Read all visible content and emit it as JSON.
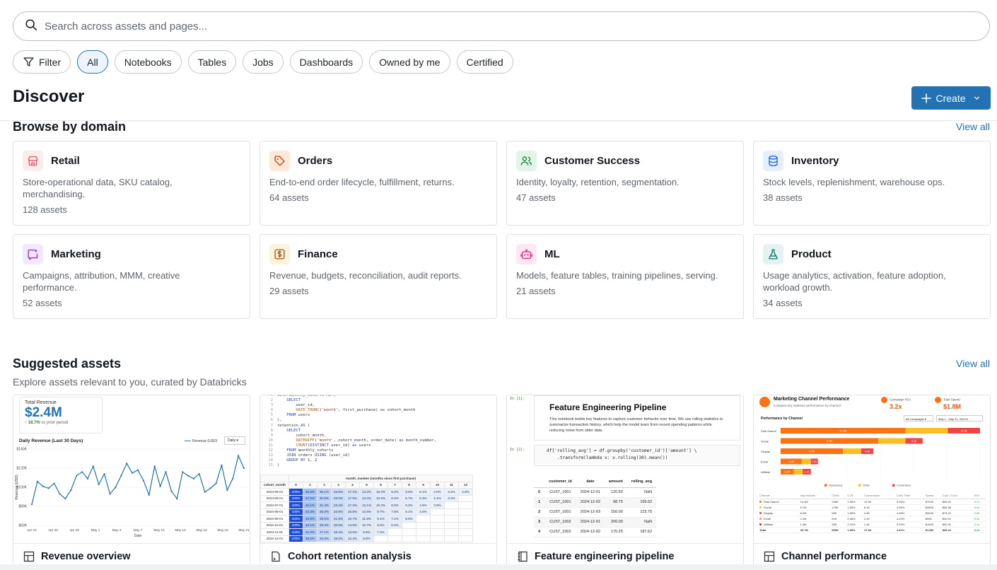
{
  "search": {
    "placeholder": "Search across assets and pages..."
  },
  "filters": {
    "filter_label": "Filter",
    "chips": [
      "All",
      "Notebooks",
      "Tables",
      "Jobs",
      "Dashboards",
      "Owned by me",
      "Certified"
    ],
    "active": "All"
  },
  "header": {
    "title": "Discover",
    "create_label": "Create"
  },
  "browse": {
    "title": "Browse by domain",
    "view_all": "View all",
    "domains": [
      {
        "name": "Retail",
        "desc": "Store-operational data, SKU catalog, merchandising.",
        "count": "128 assets",
        "icon": "store-icon",
        "color": "#e35d6a",
        "bg": "#fdecee"
      },
      {
        "name": "Orders",
        "desc": "End-to-end order lifecycle, fulfillment, returns.",
        "count": "64 assets",
        "icon": "tag-icon",
        "color": "#c2410c",
        "bg": "#fde9d7"
      },
      {
        "name": "Customer Success",
        "desc": "Identity, loyalty, retention, segmentation.",
        "count": "47 assets",
        "icon": "users-icon",
        "color": "#15803d",
        "bg": "#e3f4e9"
      },
      {
        "name": "Inventory",
        "desc": "Stock levels, replenishment, warehouse ops.",
        "count": "38 assets",
        "icon": "database-icon",
        "color": "#2563eb",
        "bg": "#e6effc"
      },
      {
        "name": "Marketing",
        "desc": "Campaigns, attribution, MMM, creative performance.",
        "count": "52 assets",
        "icon": "sparkle-message-icon",
        "color": "#9333ea",
        "bg": "#f3e8fd"
      },
      {
        "name": "Finance",
        "desc": "Revenue, budgets, reconciliation, audit reports.",
        "count": "29 assets",
        "icon": "dollar-icon",
        "color": "#b45309",
        "bg": "#fdf3dc"
      },
      {
        "name": "ML",
        "desc": "Models, feature tables, training pipelines, serving.",
        "count": "21 assets",
        "icon": "robot-icon",
        "color": "#db2777",
        "bg": "#fde7f1"
      },
      {
        "name": "Product",
        "desc": "Usage analytics, activation, feature adoption, workload growth.",
        "count": "34 assets",
        "icon": "flask-icon",
        "color": "#0f766e",
        "bg": "#e4f2f2"
      }
    ]
  },
  "suggested": {
    "title": "Suggested assets",
    "subtitle": "Explore assets relevant to you, curated by Databricks",
    "view_all": "View all",
    "assets": [
      {
        "name": "Revenue overview",
        "icon": "dashboard-icon"
      },
      {
        "name": "Cohort retention analysis",
        "icon": "query-file-icon"
      },
      {
        "name": "Feature engineering pipeline",
        "icon": "notebook-icon"
      },
      {
        "name": "Channel performance",
        "icon": "dashboard-icon"
      }
    ]
  },
  "thumb_revenue": {
    "kpi_label": "Total Revenue",
    "kpi_value": "$2.4M",
    "kpi_change": "↑ 18.7%",
    "kpi_change_note": "vs prior period",
    "chart_title": "Daily Revenue (Last 30 Days)",
    "legend": "Revenue (USD)",
    "period": "Daily"
  },
  "thumb_cohort": {
    "header_note": "month_number (months since first purchase)",
    "row_header": "cohort_month",
    "cols": [
      "0",
      "1",
      "2",
      "3",
      "4",
      "5",
      "6",
      "7",
      "8",
      "9",
      "10",
      "11",
      "12"
    ],
    "rows": [
      {
        "m": "2024-05-01",
        "v": [
          "100%",
          "45.2%",
          "30.1%",
          "22.5%",
          "17.1%",
          "13.2%",
          "10.3%",
          "8.2%",
          "6.6%",
          "5.1%",
          "4.0%",
          "3.2%",
          "2.6%"
        ]
      },
      {
        "m": "2024-06-01",
        "v": [
          "100%",
          "47.0%",
          "31.6%",
          "23.0%",
          "17.5%",
          "13.4%",
          "10.6%",
          "8.4%",
          "6.7%",
          "5.3%",
          "4.1%",
          "3.3%",
          ""
        ]
      },
      {
        "m": "2024-07-01",
        "v": [
          "100%",
          "46.1%",
          "31.4%",
          "23.4%",
          "17.2%",
          "13.1%",
          "10.2%",
          "8.0%",
          "6.3%",
          "4.9%",
          "3.8%",
          "",
          ""
        ]
      },
      {
        "m": "2024-08-01",
        "v": [
          "100%",
          "44.3%",
          "30.2%",
          "22.6%",
          "16.6%",
          "12.6%",
          "9.7%",
          "7.6%",
          "6.1%",
          "4.6%",
          "",
          "",
          ""
        ]
      },
      {
        "m": "2024-09-01",
        "v": [
          "100%",
          "43.8%",
          "29.5%",
          "21.8%",
          "15.7%",
          "11.8%",
          "9.1%",
          "7.1%",
          "5.5%",
          "",
          "",
          "",
          ""
        ]
      },
      {
        "m": "2024-10-01",
        "v": [
          "100%",
          "42.1%",
          "28.3%",
          "20.6%",
          "14.6%",
          "10.7%",
          "8.2%",
          "6.4%",
          "",
          "",
          "",
          "",
          ""
        ]
      },
      {
        "m": "2024-11-01",
        "v": [
          "100%",
          "41.0%",
          "27.1%",
          "19.4%",
          "13.5%",
          "9.6%",
          "7.2%",
          "",
          "",
          "",
          "",
          "",
          ""
        ]
      },
      {
        "m": "2024-12-01",
        "v": [
          "100%",
          "39.5%",
          "25.8%",
          "18.2%",
          "12.4%",
          "8.6%",
          "",
          "",
          "",
          "",
          "",
          "",
          ""
        ]
      }
    ]
  },
  "thumb_feature": {
    "prompt1": "In [1]:",
    "prompt2": "In [2]:",
    "title": "Feature Engineering Pipeline",
    "body": "This notebook builds key features to capture customer behavior over time. We use rolling statistics to summarize transaction history, which help the model learn from recent spending patterns while reducing noise from older data.",
    "code": "df['rolling_avg'] = df.groupby('customer_id')['amount'] \\\n    .transform(lambda x: x.rolling(30).mean())",
    "columns": [
      "",
      "customer_id",
      "date",
      "amount",
      "rolling_avg"
    ],
    "rows": [
      [
        "0",
        "CUST_1001",
        "2024-12-01",
        "120.50",
        "NaN"
      ],
      [
        "1",
        "CUST_1001",
        "2024-12-02",
        "98.75",
        "109.62"
      ],
      [
        "2",
        "CUST_1001",
        "2024-12-03",
        "150.00",
        "123.75"
      ],
      [
        "3",
        "CUST_1002",
        "2024-12-01",
        "200.00",
        "NaN"
      ],
      [
        "4",
        "CUST_1002",
        "2024-12-02",
        "175.25",
        "187.62"
      ]
    ]
  },
  "thumb_channel": {
    "title": "Marketing Channel Performance",
    "subtitle": "Compare key statistics performance by channel",
    "kpi1_label": "Campaign ROI",
    "kpi1_value": "3.2x",
    "kpi2_label": "Total Spend",
    "kpi2_value": "$1.8M",
    "section": "Performance by Channel",
    "campaign_select": "All Campaigns",
    "date_range": "May 1 - May 31, 2024",
    "legend": [
      "Impressions",
      "Clicks",
      "Conversions"
    ],
    "table_cols": [
      "Channel",
      "Impressions",
      "Clicks",
      "CTR",
      "Conversions",
      "Conv. Rate",
      "Spend",
      "Cost / Conv.",
      "ROI"
    ],
    "table_rows": [
      [
        "Paid Search",
        "12.4M",
        "245K",
        "1.98%",
        "12.9K",
        "5.26%",
        "$720K",
        "$55.81",
        "4.1x"
      ],
      [
        "Social",
        "9.7M",
        "178K",
        "1.83%",
        "8.1K",
        "4.55%",
        "$450K",
        "$55.56",
        "3.4x"
      ],
      [
        "Display",
        "6.2M",
        "96K",
        "1.55%",
        "4.3K",
        "4.48%",
        "$320K",
        "$74.42",
        "2.6x"
      ],
      [
        "Email",
        "2.1M",
        "52K",
        "2.48%",
        "2.2K",
        "4.23%",
        "$90K",
        "$40.91",
        "5.2x"
      ],
      [
        "Affiliate",
        "1.3M",
        "28K",
        "2.15%",
        "1.1K",
        "3.93%",
        "$100K",
        "$90.91",
        "2.1x"
      ]
    ],
    "total_row": [
      "Total",
      "30.7M",
      "599K",
      "1.95%",
      "27.6K",
      "4.61%",
      "$1.8M",
      "$65.22",
      "3.2x"
    ]
  },
  "chart_data": [
    {
      "type": "line",
      "title": "Daily Revenue (Last 30 Days)",
      "xlabel": "Date",
      "ylabel": "Revenue (USD)",
      "x_ticks": [
        "Apr 22",
        "Apr 25",
        "Apr 28",
        "May 1",
        "May 4",
        "May 7",
        "May 10",
        "May 13",
        "May 16",
        "May 19",
        "May 21"
      ],
      "y_ticks": [
        "$60K",
        "$80K",
        "$100K",
        "$120K",
        "$140K"
      ],
      "ylim": [
        60000,
        140000
      ],
      "series": [
        {
          "name": "Revenue (USD)",
          "values": [
            82000,
            106000,
            101000,
            99000,
            104000,
            93000,
            88000,
            97000,
            112000,
            116000,
            109000,
            122000,
            103000,
            114000,
            93000,
            100000,
            112000,
            125000,
            115000,
            118000,
            107000,
            92000,
            122000,
            101000,
            116000,
            96000,
            88000,
            116000,
            112000,
            109000,
            114000,
            95000,
            99000,
            104000,
            123000,
            97000,
            109000,
            133000,
            120000
          ]
        }
      ],
      "grid": true,
      "legend": "top-right"
    },
    {
      "type": "bar",
      "title": "Performance by Channel",
      "categories": [
        "Paid Search",
        "Social",
        "Display",
        "Email",
        "Affiliate"
      ],
      "series": [
        {
          "name": "Impressions",
          "values": [
            12.4,
            9.7,
            6.2,
            2.1,
            1.3
          ],
          "labels": [
            "12.4M",
            "9.7M",
            "6.2M",
            "2.1M",
            "1.3M"
          ],
          "color": "#f97316"
        },
        {
          "name": "Clicks",
          "values": [
            4.2,
            2.7,
            1.8,
            0.9,
            0.9
          ],
          "labels": [
            "",
            "",
            "",
            "",
            ""
          ],
          "color": "#fbbf24"
        },
        {
          "name": "Conversions",
          "values": [
            3.2,
            1.7,
            1.2,
            0.7,
            0.8
          ],
          "labels": [
            "12.9K",
            "8.1K",
            "4.3K",
            "2.2K",
            "1.1K"
          ],
          "color": "#ef4444"
        }
      ],
      "grid": true,
      "legend": "bottom"
    }
  ]
}
